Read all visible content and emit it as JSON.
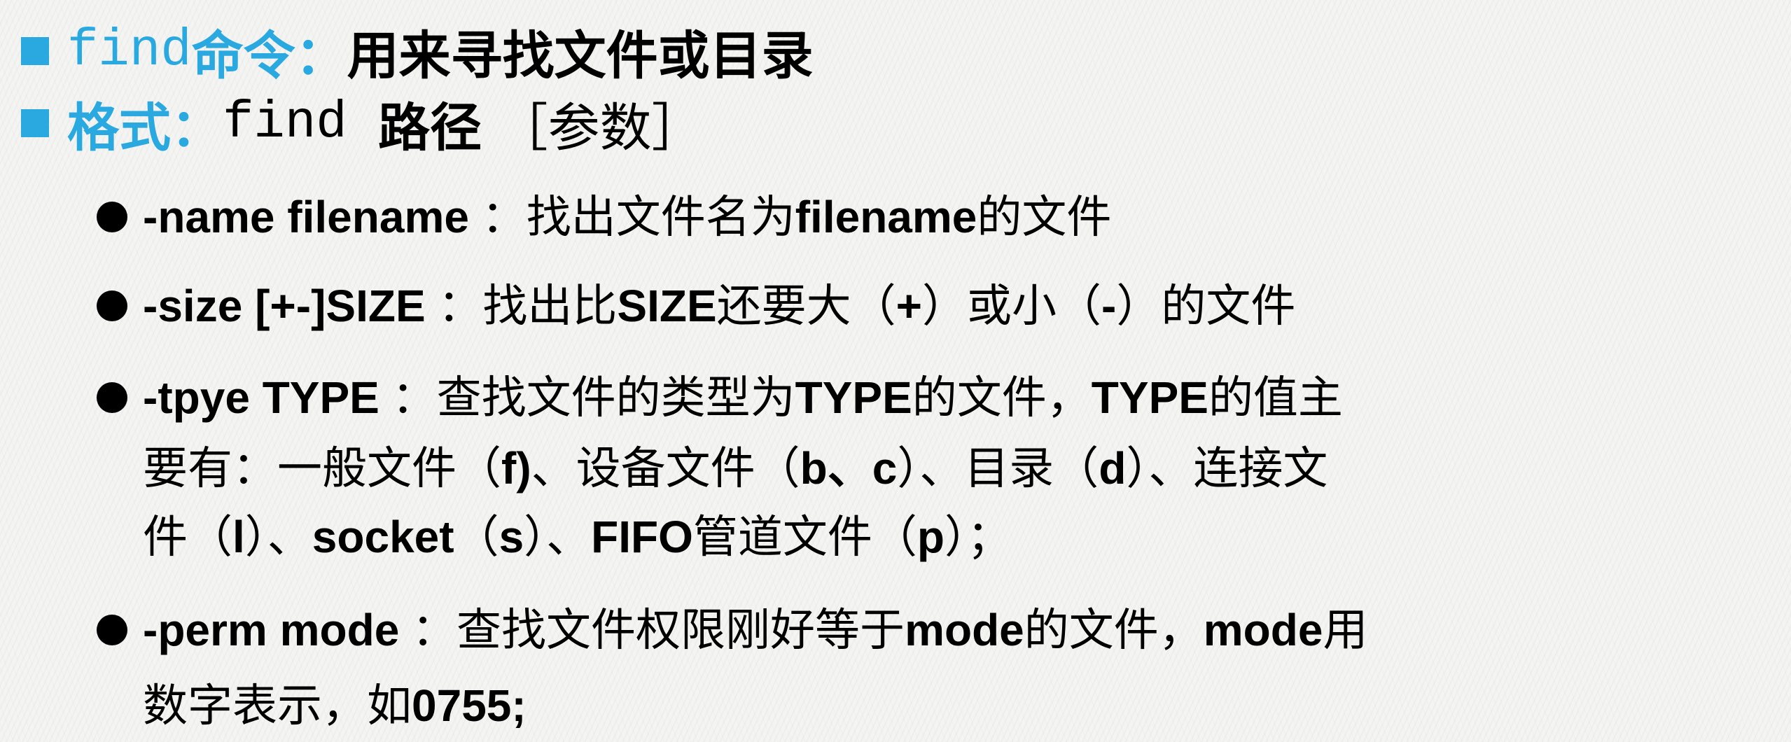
{
  "heading1": {
    "cmd": "find",
    "cmd_suffix": "命令：",
    "desc": "用来寻找文件或目录"
  },
  "heading2": {
    "label": "格式：",
    "cmd": "find ",
    "path": "路径 ",
    "params": "［参数］"
  },
  "bullets": [
    {
      "lines": [
        [
          {
            "t": "-name filename",
            "b": true
          },
          {
            "t": " ：找出文件名为"
          },
          {
            "t": "filename",
            "b": true
          },
          {
            "t": "的文件"
          }
        ]
      ]
    },
    {
      "lines": [
        [
          {
            "t": "-size [+-]SIZE",
            "b": true
          },
          {
            "t": " ：找出比"
          },
          {
            "t": "SIZE",
            "b": true
          },
          {
            "t": "还要大（"
          },
          {
            "t": "+",
            "b": true
          },
          {
            "t": "）或小（"
          },
          {
            "t": "-",
            "b": true
          },
          {
            "t": "）的文件"
          }
        ]
      ]
    },
    {
      "lines": [
        [
          {
            "t": "-tpye TYPE",
            "b": true
          },
          {
            "t": " ：查找文件的类型为"
          },
          {
            "t": "TYPE",
            "b": true
          },
          {
            "t": "的文件，"
          },
          {
            "t": "TYPE",
            "b": true
          },
          {
            "t": "的值主"
          }
        ],
        [
          {
            "t": "要有：一般文件（"
          },
          {
            "t": "f)",
            "b": true
          },
          {
            "t": "、设备文件（"
          },
          {
            "t": "b、c",
            "b": true
          },
          {
            "t": "）、目录（"
          },
          {
            "t": "d",
            "b": true
          },
          {
            "t": "）、连接文"
          }
        ],
        [
          {
            "t": "件（"
          },
          {
            "t": "l",
            "b": true
          },
          {
            "t": "）、"
          },
          {
            "t": "socket",
            "b": true
          },
          {
            "t": "（"
          },
          {
            "t": "s",
            "b": true
          },
          {
            "t": "）、"
          },
          {
            "t": "FIFO",
            "b": true
          },
          {
            "t": "管道文件（"
          },
          {
            "t": "p",
            "b": true
          },
          {
            "t": "）；"
          }
        ]
      ]
    },
    {
      "lines": [
        [
          {
            "t": "-perm mode",
            "b": true
          },
          {
            "t": " ：查找文件权限刚好等于"
          },
          {
            "t": "mode",
            "b": true
          },
          {
            "t": "的文件，"
          },
          {
            "t": "mode",
            "b": true
          },
          {
            "t": "用"
          }
        ],
        [
          {
            "t": "数字表示，如"
          },
          {
            "t": "0755;",
            "b": true
          }
        ]
      ]
    }
  ],
  "colors": {
    "accent": "#29a9e0",
    "text": "#000000"
  }
}
